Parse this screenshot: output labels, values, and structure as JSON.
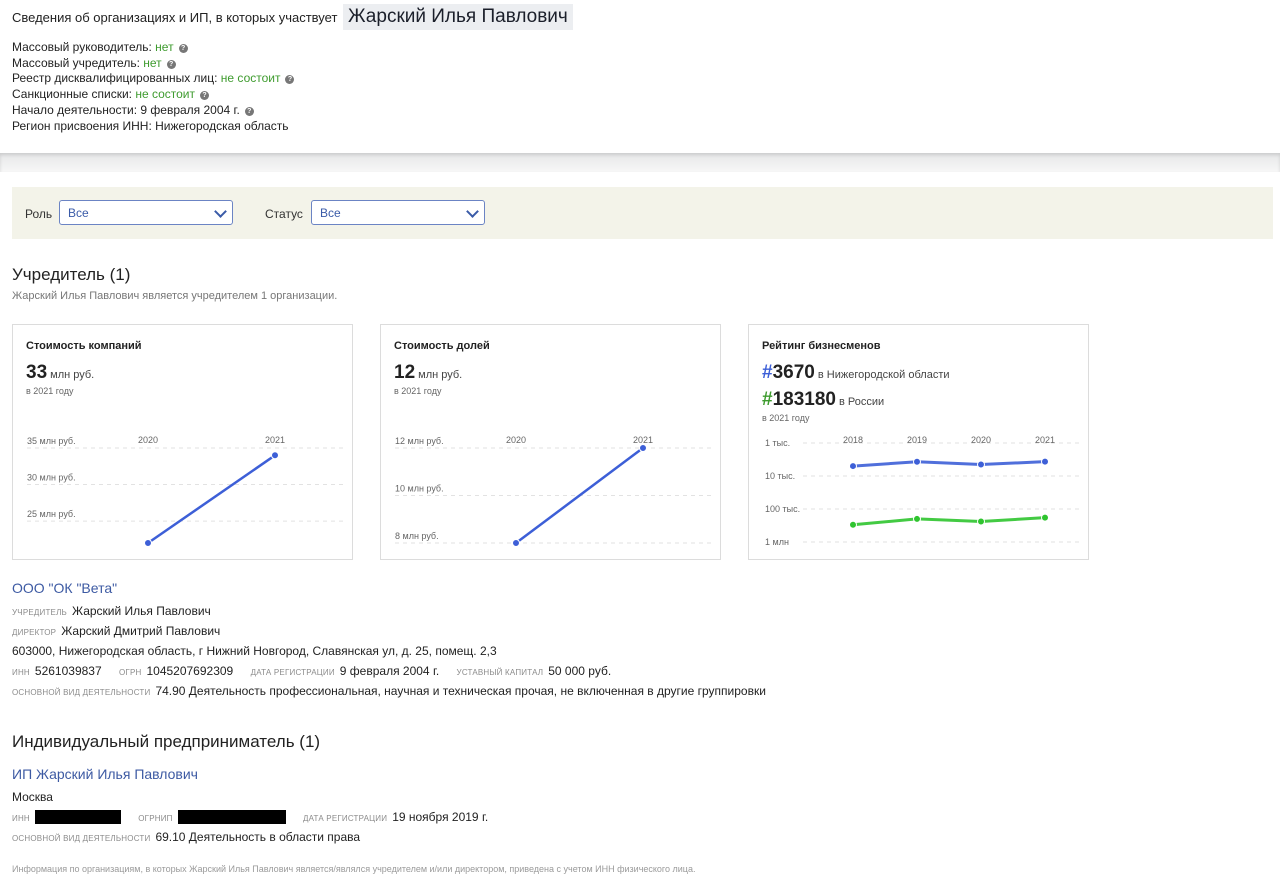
{
  "header": {
    "prefix": "Сведения об организациях и ИП, в которых участвует",
    "name": "Жарский Илья Павлович"
  },
  "facts": [
    {
      "label": "Массовый руководитель:",
      "value": "нет",
      "help": true,
      "green": true
    },
    {
      "label": "Массовый учредитель:",
      "value": "нет",
      "help": true,
      "green": true
    },
    {
      "label": "Реестр дисквалифицированных лиц:",
      "value": "не состоит",
      "help": true,
      "green": true
    },
    {
      "label": "Санкционные списки:",
      "value": "не состоит",
      "help": true,
      "green": true
    },
    {
      "label": "Начало деятельности:",
      "value": "9 февраля 2004 г.",
      "help": true,
      "green": false
    },
    {
      "label": "Регион присвоения ИНН:",
      "value": "Нижегородская область",
      "help": false,
      "green": false
    }
  ],
  "filters": {
    "role_label": "Роль",
    "role_value": "Все",
    "status_label": "Статус",
    "status_value": "Все"
  },
  "founder": {
    "title": "Учредитель (1)",
    "subtitle": "Жарский Илья Павлович является учредителем 1 организации."
  },
  "cards": {
    "company_value": {
      "title": "Стоимость компаний",
      "value": "33",
      "unit": "млн руб.",
      "year_note": "в 2021 году"
    },
    "shares_value": {
      "title": "Стоимость долей",
      "value": "12",
      "unit": "млн руб.",
      "year_note": "в 2021 году"
    },
    "rating": {
      "title": "Рейтинг бизнесменов",
      "region_rank": "#3670",
      "region_label": "в Нижегородской области",
      "country_rank": "#183180",
      "country_label": "в России",
      "year_note": "в 2021 году"
    }
  },
  "chart_data": [
    {
      "type": "line",
      "x": [
        "2020",
        "2021"
      ],
      "series": [
        {
          "values": [
            22,
            34
          ]
        }
      ],
      "yticks": [
        "35 млн руб.",
        "30 млн руб.",
        "25 млн руб."
      ],
      "ytick_values": [
        35,
        30,
        25
      ],
      "ylim": [
        22,
        35
      ],
      "color": "#3d5fd7"
    },
    {
      "type": "line",
      "x": [
        "2020",
        "2021"
      ],
      "series": [
        {
          "values": [
            8,
            12
          ]
        }
      ],
      "yticks": [
        "12 млн руб.",
        "10 млн руб.",
        "8 млн руб."
      ],
      "ytick_values": [
        12,
        10,
        8
      ],
      "ylim": [
        8,
        12
      ],
      "color": "#3d5fd7"
    },
    {
      "type": "line",
      "scale": "log",
      "x": [
        "2018",
        "2019",
        "2020",
        "2021"
      ],
      "series": [
        {
          "values": [
            5000,
            3700,
            4500,
            3670
          ],
          "color": "#3d5fd7"
        },
        {
          "values": [
            300000,
            200000,
            240000,
            183180
          ],
          "color": "#2fc42f"
        }
      ],
      "yticks": [
        "1 тыс.",
        "10 тыс.",
        "100 тыс.",
        "1 млн"
      ],
      "ytick_values": [
        1000,
        10000,
        100000,
        1000000
      ]
    }
  ],
  "organization": {
    "name": "ООО \"ОК \"Вета\"",
    "founder_label": "учредитель",
    "founder": "Жарский Илья Павлович",
    "director_label": "директор",
    "director": "Жарский Дмитрий Павлович",
    "address": "603000, Нижегородская область, г Нижний Новгород, Славянская ул, д. 25, помещ. 2,3",
    "inn_label": "инн",
    "inn": "5261039837",
    "ogrn_label": "огрн",
    "ogrn": "1045207692309",
    "reg_label": "дата регистрации",
    "reg_date": "9 февраля 2004 г.",
    "capital_label": "уставный капитал",
    "capital": "50 000 руб.",
    "activity_label": "основной вид деятельности",
    "activity": "74.90 Деятельность профессиональная, научная и техническая прочая, не включенная в другие группировки"
  },
  "entrepreneur": {
    "title": "Индивидуальный предприниматель (1)",
    "name": "ИП Жарский Илья Павлович",
    "city": "Москва",
    "inn_label": "инн",
    "ogrnip_label": "огрнип",
    "reg_label": "дата регистрации",
    "reg_date": "19 ноября 2019 г.",
    "activity_label": "основной вид деятельности",
    "activity": "69.10 Деятельность в области права"
  },
  "footnote": "Информация по организациям, в которых Жарский Илья Павлович является/являлся учредителем и/или директором, приведена с учетом ИНН физического лица."
}
